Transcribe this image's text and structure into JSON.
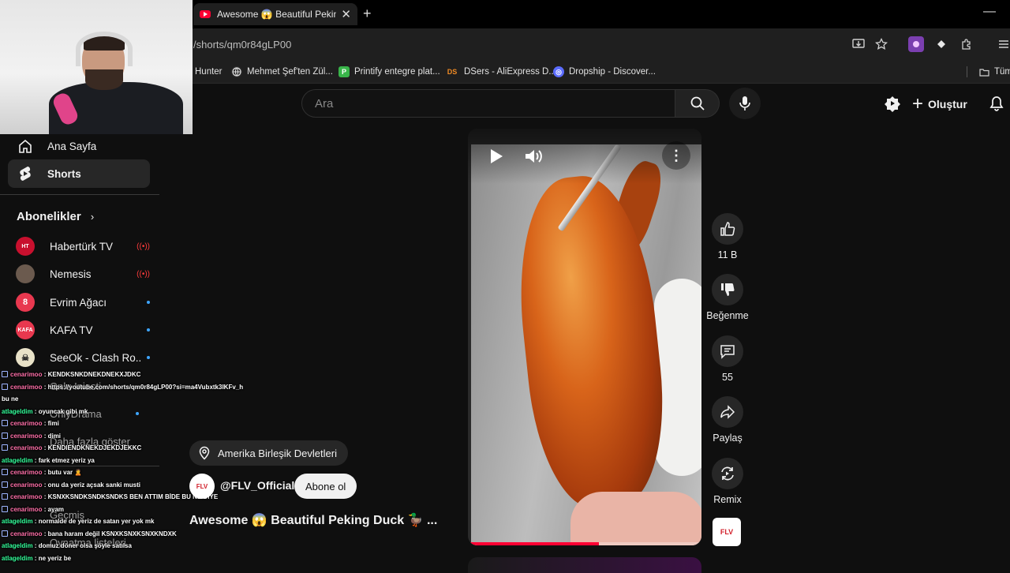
{
  "browser": {
    "tab_title": "Awesome 😱 Beautiful Peking Duck",
    "tab_close": "✕",
    "new_tab": "+",
    "minimize": "—",
    "url": "/shorts/qm0r84gLP00",
    "bookmarks": [
      {
        "label": "Hunter",
        "icon": ""
      },
      {
        "label": "Mehmet Şef'ten Zül...",
        "icon": "globe-icon"
      },
      {
        "label": "Printify entegre plat...",
        "icon": "printify-icon"
      },
      {
        "label": "DSers - AliExpress D...",
        "icon": "dsers-icon"
      },
      {
        "label": "Dropship - Discover...",
        "icon": "dropship-icon"
      }
    ],
    "bookmarks_folder": "Tüm"
  },
  "search": {
    "placeholder": "Ara"
  },
  "header": {
    "create_label": "Oluştur"
  },
  "sidebar": {
    "items": [
      {
        "label": "Ana Sayfa",
        "icon": "home-icon"
      },
      {
        "label": "Shorts",
        "icon": "shorts-icon"
      }
    ],
    "subscriptions_heading": "Abonelikler",
    "subscriptions": [
      {
        "name": "Habertürk TV",
        "avatar_text": "HABER TÜRK",
        "avatar_color": "#c8102e",
        "status": "live"
      },
      {
        "name": "Nemesis",
        "avatar_text": "",
        "avatar_color": "#6b5a4e",
        "status": "live"
      },
      {
        "name": "Evrim Ağacı",
        "avatar_text": "",
        "avatar_color": "#e8384f",
        "status": "new"
      },
      {
        "name": "KAFA TV",
        "avatar_text": "KAFA",
        "avatar_color": "#e8384f",
        "status": "new"
      },
      {
        "name": "SeeOk - Clash Ro...",
        "avatar_text": "",
        "avatar_color": "#e9e2c8",
        "status": "new"
      }
    ],
    "obscured": [
      "Onlu Iniasti",
      "OnlyDrama",
      "Daha fazla göster",
      "Geçmiş",
      "Oynatma listeleri"
    ]
  },
  "chat": [
    {
      "user": "cenarimoo",
      "text": ": KENDKSNKDNEKDNEKXJDKC"
    },
    {
      "user": "cenarimoo",
      "text": ": https://youtube.com/shorts/qm0r84gLP00?si=ma4Vubxtk3IKFv_h"
    },
    {
      "user": "",
      "text": "bu ne"
    },
    {
      "user": "atlageldim",
      "text": ": oyuncak gibi mk"
    },
    {
      "user": "cenarimoo",
      "text": ": fimi"
    },
    {
      "user": "cenarimoo",
      "text": ": dimi"
    },
    {
      "user": "cenarimoo",
      "text": ": KENDIENDKNEKDJEKDJEKKC"
    },
    {
      "user": "atlageldim",
      "text": ": fark etmez yeriz ya"
    },
    {
      "user": "cenarimoo",
      "text": ": butu var 🙎"
    },
    {
      "user": "cenarimoo",
      "text": ": onu da yeriz açsak sanki musti"
    },
    {
      "user": "cenarimoo",
      "text": ": KSNXKSNDKSNDKSNDKS BEN ATTIM BİDE BU NE DİYE"
    },
    {
      "user": "cenarimoo",
      "text": ": ayam"
    },
    {
      "user": "atlageldim",
      "text": ": normalde de yeriz de satan yer yok mk"
    },
    {
      "user": "cenarimoo",
      "text": ": bana haram değil KSNXKSNXKSNXKNDXK"
    },
    {
      "user": "atlageldim",
      "text": ": domuz döner olsa şöyle satılsa"
    },
    {
      "user": "atlageldim",
      "text": ": ne yeriz be"
    }
  ],
  "video": {
    "progress": 0.56,
    "more_label": "⋮"
  },
  "actions": {
    "like_count": "11 B",
    "dislike_label": "Beğenme",
    "comment_count": "55",
    "share_label": "Paylaş",
    "remix_label": "Remix"
  },
  "info": {
    "location": "Amerika Birleşik Devletleri",
    "channel_handle": "@FLV_Official",
    "channel_logo_text": "FLV",
    "subscribe_label": "Abone ol",
    "title": "Awesome 😱 Beautiful Peking Duck 🦆 ..."
  },
  "colors": {
    "accent_red": "#ff0033",
    "background": "#0f0f0f",
    "chat_user_pink": "#ff6fa8",
    "chat_user_green": "#33ff9b"
  }
}
